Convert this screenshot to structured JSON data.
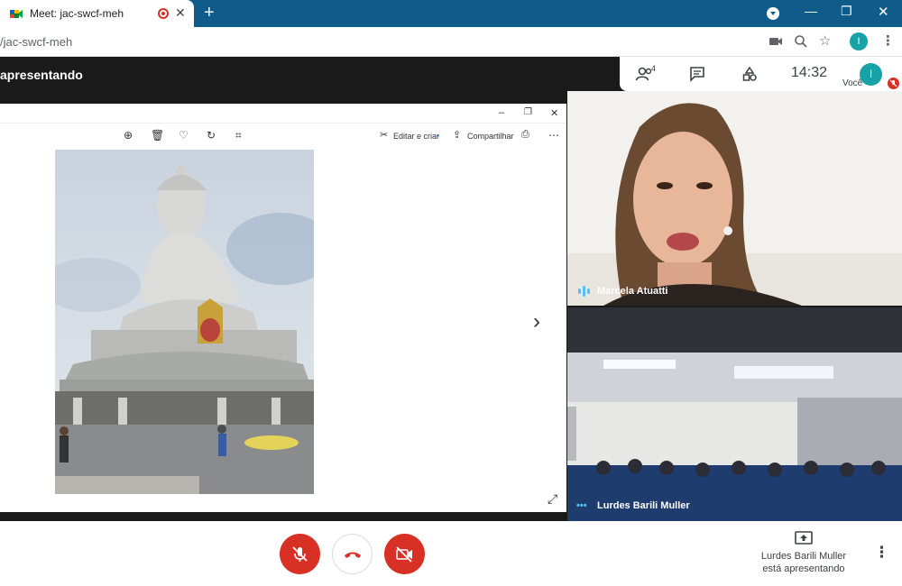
{
  "browser": {
    "tab_title": "Meet: jac-swcf-meh",
    "url": "/jac-swcf-meh",
    "profile_initial": "I"
  },
  "meet": {
    "presenting_label": "apresentando",
    "participants_count": "4",
    "time": "14:32",
    "self_label": "Você",
    "self_initial": "I"
  },
  "photos_app": {
    "edit_create_label": "Editar e criar",
    "share_label": "Compartilhar"
  },
  "tiles": [
    {
      "name": "Marcela Atuatti"
    },
    {
      "name": "Lurdes Barili Muller"
    }
  ],
  "presentation_status": {
    "line1": "Lurdes Barili Muller",
    "line2": "está apresentando"
  },
  "colors": {
    "tabstrip": "#0f5c8a",
    "meet_red": "#d93025",
    "avatar_teal": "#17a2a8"
  }
}
